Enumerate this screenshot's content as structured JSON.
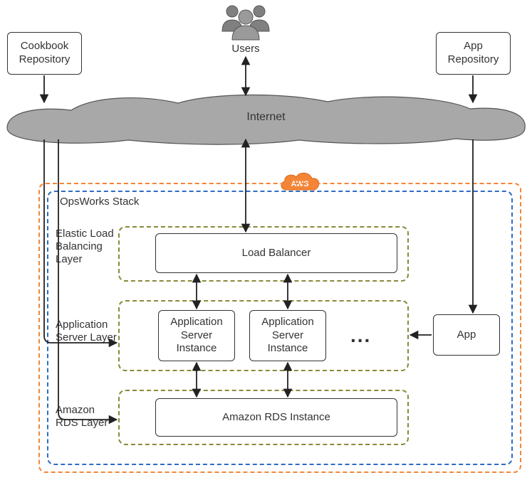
{
  "repos": {
    "cookbook": "Cookbook\nRepository",
    "app": "App\nRepository"
  },
  "users_label": "Users",
  "internet_label": "Internet",
  "aws_label": "AWS",
  "stack": {
    "title": "OpsWorks Stack",
    "layers": {
      "elb": {
        "label": "Elastic Load\nBalancing\nLayer",
        "node": "Load Balancer"
      },
      "app": {
        "label": "Application\nServer Layer",
        "instance1": "Application\nServer\nInstance",
        "instance2": "Application\nServer\nInstance",
        "more": "..."
      },
      "rds": {
        "label": "Amazon\nRDS Layer",
        "node": "Amazon RDS Instance"
      }
    },
    "app_node": "App"
  }
}
